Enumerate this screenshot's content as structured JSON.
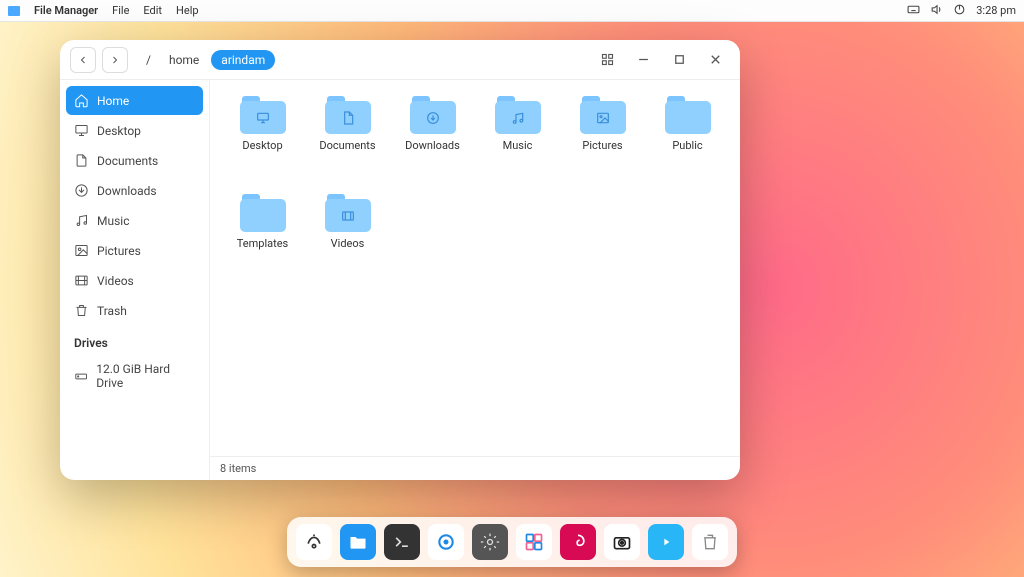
{
  "panel": {
    "app_title": "File Manager",
    "menus": [
      "File",
      "Edit",
      "Help"
    ],
    "clock": "3:28 pm"
  },
  "window": {
    "path": {
      "root": "/",
      "crumb1": "home",
      "crumb2": "arindam"
    },
    "sidebar": {
      "items": [
        {
          "label": "Home",
          "icon": "home"
        },
        {
          "label": "Desktop",
          "icon": "monitor"
        },
        {
          "label": "Documents",
          "icon": "file"
        },
        {
          "label": "Downloads",
          "icon": "download"
        },
        {
          "label": "Music",
          "icon": "music"
        },
        {
          "label": "Pictures",
          "icon": "image"
        },
        {
          "label": "Videos",
          "icon": "video"
        },
        {
          "label": "Trash",
          "icon": "trash"
        }
      ],
      "drives_header": "Drives",
      "drive": "12.0 GiB Hard Drive"
    },
    "folders": [
      {
        "label": "Desktop",
        "icon": "monitor"
      },
      {
        "label": "Documents",
        "icon": "file"
      },
      {
        "label": "Downloads",
        "icon": "download"
      },
      {
        "label": "Music",
        "icon": "music"
      },
      {
        "label": "Pictures",
        "icon": "image"
      },
      {
        "label": "Public",
        "icon": ""
      },
      {
        "label": "Templates",
        "icon": ""
      },
      {
        "label": "Videos",
        "icon": "video"
      }
    ],
    "status": "8 items"
  },
  "dock": {
    "items": [
      {
        "name": "launcher",
        "bg": "#ffffff",
        "fg": "#333333"
      },
      {
        "name": "files",
        "bg": "#2196f3",
        "fg": "#ffffff"
      },
      {
        "name": "terminal",
        "bg": "#333333",
        "fg": "#dddddd"
      },
      {
        "name": "browser",
        "bg": "#ffffff",
        "fg": "#1e88e5"
      },
      {
        "name": "settings",
        "bg": "#555555",
        "fg": "#dddddd"
      },
      {
        "name": "screenshot",
        "bg": "#ffffff",
        "fg": "#1e88e5"
      },
      {
        "name": "debian",
        "bg": "#d70a53",
        "fg": "#ffffff"
      },
      {
        "name": "camera",
        "bg": "#ffffff",
        "fg": "#222222"
      },
      {
        "name": "player",
        "bg": "#29b6f6",
        "fg": "#ffffff"
      },
      {
        "name": "trash",
        "bg": "#ffffff",
        "fg": "#888888"
      }
    ]
  }
}
